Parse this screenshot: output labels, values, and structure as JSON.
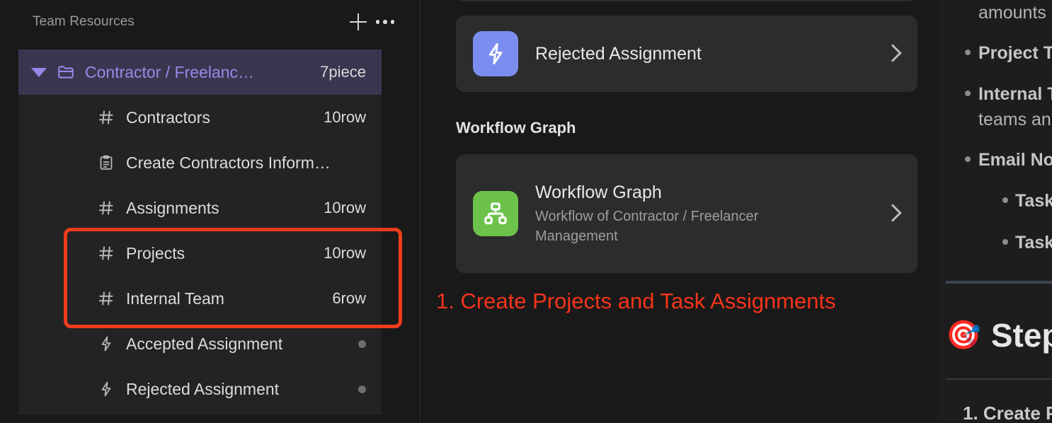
{
  "sidebar": {
    "title": "Team Resources",
    "add_icon": "plus-icon",
    "more_icon": "ellipsis-icon",
    "folder": {
      "name": "Contractor / Freelanc…",
      "count": "7piece",
      "caret_icon": "caret-down-icon",
      "folder_icon": "folder-icon",
      "accent_color": "#9b87e8",
      "row_background": "#3b3650"
    },
    "items": [
      {
        "icon": "table-icon",
        "label": "Contractors",
        "meta": "10row",
        "meta_type": "text"
      },
      {
        "icon": "clipboard-icon",
        "label": "Create Contractors Inform…",
        "meta": "",
        "meta_type": "none"
      },
      {
        "icon": "table-icon",
        "label": "Assignments",
        "meta": "10row",
        "meta_type": "text"
      },
      {
        "icon": "table-icon",
        "label": "Projects",
        "meta": "10row",
        "meta_type": "text"
      },
      {
        "icon": "table-icon",
        "label": "Internal Team",
        "meta": "6row",
        "meta_type": "text"
      },
      {
        "icon": "zap-icon",
        "label": "Accepted Assignment",
        "meta": "",
        "meta_type": "dot"
      },
      {
        "icon": "zap-icon",
        "label": "Rejected Assignment",
        "meta": "",
        "meta_type": "dot"
      }
    ],
    "highlight": {
      "color": "#f03c1e",
      "covers": [
        "Projects",
        "Internal Team"
      ]
    }
  },
  "center": {
    "cards": [
      {
        "title": "Rejected Assignment",
        "subtitle": "",
        "icon": "zap-icon",
        "icon_bg": "#7b8ef0",
        "chevron_icon": "chevron-right-icon"
      }
    ],
    "section_label": "Workflow Graph",
    "workflow_card": {
      "title": "Workflow Graph",
      "subtitle": "Workflow of Contractor / Freelancer Management",
      "icon": "hierarchy-icon",
      "icon_bg": "#6cc24a",
      "chevron_icon": "chevron-right-icon"
    },
    "annotation": "1. Create Projects and Task Assignments",
    "annotation_color": "#f5341b"
  },
  "doc": {
    "cut_top_line": "amounts",
    "bullets": [
      {
        "lead": "Project T",
        "cont": "",
        "nested": false
      },
      {
        "lead": "Internal T",
        "cont": "teams an",
        "nested": false
      },
      {
        "lead": "Email No",
        "cont": "",
        "nested": false
      },
      {
        "lead": "Task",
        "cont": "",
        "nested": true
      },
      {
        "lead": "Task",
        "cont": "",
        "nested": true
      }
    ],
    "step_emoji": "🎯",
    "step_heading": "Step",
    "step_item": "1. Create P"
  }
}
